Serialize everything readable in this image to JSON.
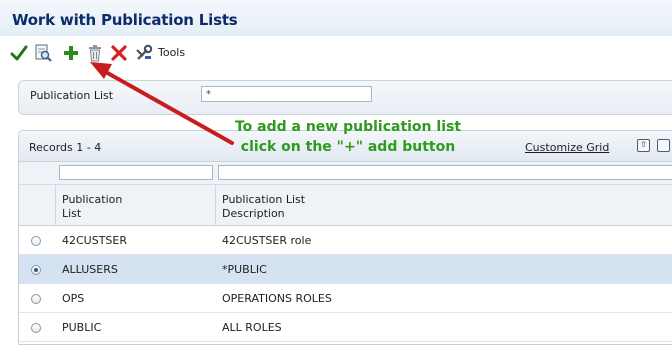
{
  "header": {
    "title": "Work with Publication Lists"
  },
  "toolbar": {
    "buttons": [
      {
        "name": "select",
        "icon": "checkmark-icon"
      },
      {
        "name": "find",
        "icon": "find-icon"
      },
      {
        "name": "add",
        "icon": "plus-icon"
      },
      {
        "name": "delete",
        "icon": "trash-icon"
      },
      {
        "name": "close",
        "icon": "close-icon"
      }
    ],
    "tools_label": "Tools"
  },
  "criteria": {
    "label": "Publication List",
    "value": "*"
  },
  "annotation": {
    "line1": "To add a new publication list",
    "line2": "click on the \"+\" add button",
    "color": "#2f9a1e",
    "arrow_color": "#cc1f1f"
  },
  "grid": {
    "records": "Records 1 - 4",
    "customize": "Customize Grid",
    "columns": [
      {
        "line1": "Publication",
        "line2": "List"
      },
      {
        "line1": "Publication List",
        "line2": "Description"
      }
    ],
    "rows": [
      {
        "list": "42CUSTSER",
        "description": "42CUSTSER role",
        "selected": false
      },
      {
        "list": "ALLUSERS",
        "description": "*PUBLIC",
        "selected": true
      },
      {
        "list": "OPS",
        "description": "OPERATIONS ROLES",
        "selected": false
      },
      {
        "list": "PUBLIC",
        "description": "ALL ROLES",
        "selected": false
      }
    ]
  },
  "colors": {
    "title": "#0c2d6b",
    "selected_row": "#d5e2f1"
  }
}
